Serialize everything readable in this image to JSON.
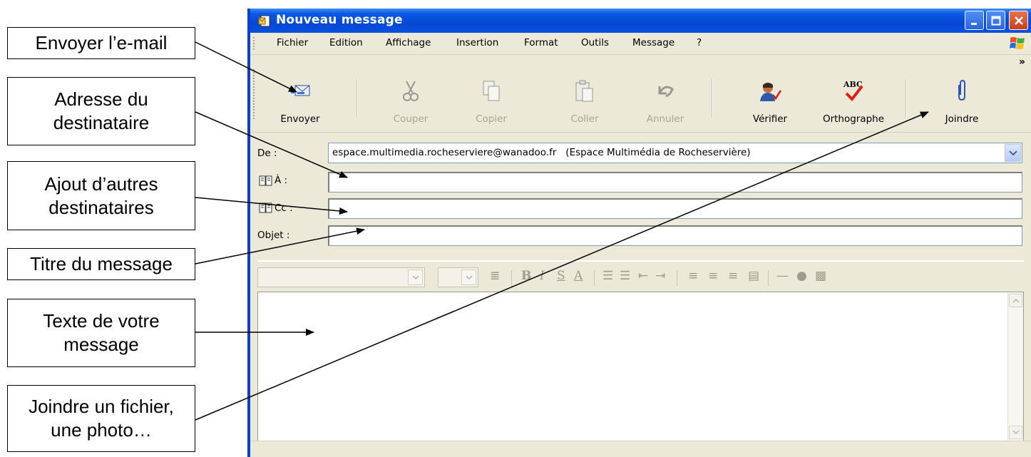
{
  "annotations": [
    {
      "id": "send",
      "text": "Envoyer l’e-mail"
    },
    {
      "id": "recipient",
      "text": "Adresse du\ndestinataire"
    },
    {
      "id": "cc",
      "text": "Ajout d’autres\ndestinataires"
    },
    {
      "id": "subject",
      "text": "Titre du message"
    },
    {
      "id": "body",
      "text": "Texte de votre\nmessage"
    },
    {
      "id": "attach",
      "text": "Joindre un fichier,\nune photo…"
    }
  ],
  "window": {
    "title": "Nouveau message",
    "menu": [
      "Fichier",
      "Edition",
      "Affichage",
      "Insertion",
      "Format",
      "Outils",
      "Message",
      "?"
    ],
    "toolbar": [
      {
        "label": "Envoyer",
        "icon": "send-mail-icon",
        "enabled": true
      },
      {
        "label": "Couper",
        "icon": "scissors-icon",
        "enabled": false
      },
      {
        "label": "Copier",
        "icon": "copy-icon",
        "enabled": false
      },
      {
        "label": "Coller",
        "icon": "paste-icon",
        "enabled": false
      },
      {
        "label": "Annuler",
        "icon": "undo-icon",
        "enabled": false
      },
      {
        "label": "Vérifier",
        "icon": "check-names-icon",
        "enabled": true
      },
      {
        "label": "Orthographe",
        "icon": "spelling-icon",
        "enabled": true
      },
      {
        "label": "Joindre",
        "icon": "paperclip-icon",
        "enabled": true
      }
    ],
    "fields": {
      "from_label": "De :",
      "from_value": "espace.multimedia.rocheserviere@wanadoo.fr   (Espace Multimédia de Rocheservière)",
      "to_label": "À :",
      "to_value": "",
      "cc_label": "Cc :",
      "cc_value": "",
      "subject_label": "Objet :",
      "subject_value": ""
    },
    "body_text": ""
  },
  "colors": {
    "titlebar": "#0548d4",
    "window_bg": "#ece9d8",
    "field_border": "#7f9db9",
    "disabled_text": "#a7a597"
  }
}
